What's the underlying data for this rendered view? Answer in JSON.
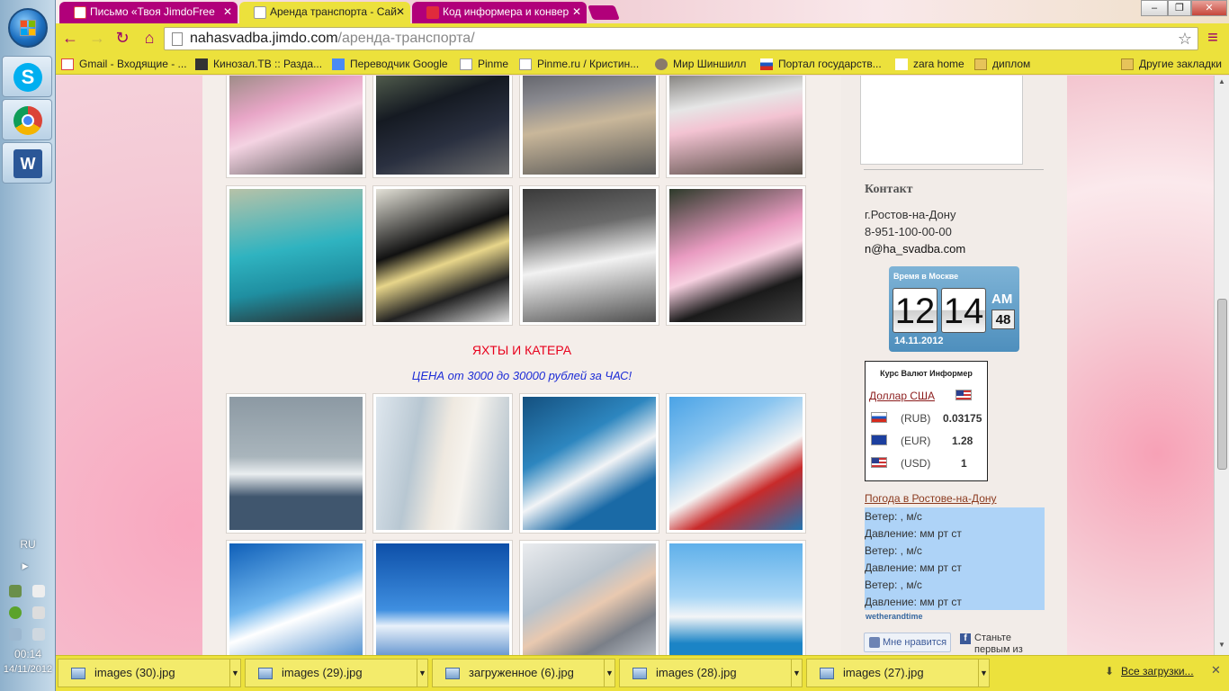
{
  "browser": {
    "tabs": [
      {
        "label": "Письмо «Твоя JimdoFree",
        "active": false
      },
      {
        "label": "Аренда транспорта - Сай",
        "active": true
      },
      {
        "label": "Код информера и конвер",
        "active": false
      }
    ],
    "close_glyph": "✕",
    "url_host": "nahasvadba.jimdo.com",
    "url_path": "/аренда-транспорта/",
    "window_buttons": [
      "‒",
      "❐",
      "✕"
    ],
    "nav_icons": [
      "back-arrow-icon",
      "forward-arrow-icon",
      "reload-icon",
      "home-icon"
    ],
    "star_glyph": "☆",
    "menu_glyph": "≡",
    "bookmarks": [
      "Gmail - Входящие - ...",
      "Кинозал.ТВ :: Разда...",
      "Переводчик Google",
      "Pinme",
      "Pinme.ru / Кристин...",
      "Мир Шиншилл",
      "Портал государств...",
      "zara home",
      "диплом"
    ],
    "other_bookmarks": "Другие закладки",
    "accent_color": "#ece13c",
    "tab_color": "#b1007a"
  },
  "taskbar": {
    "language": "RU",
    "time": "00:14",
    "date": "14/11/2012",
    "pinned_apps": [
      "skype-icon",
      "chrome-icon",
      "word-icon"
    ]
  },
  "page": {
    "yachts_title": "ЯХТЫ И КАТЕРА",
    "yachts_price": "ЦЕНА от 3000 до 30000 рублей за ЧАС!",
    "contact": {
      "heading": "Контакт",
      "city": "г.Ростов-на-Дону",
      "phone": "8-951-100-00-00",
      "email": "n@ha_svadba.com"
    },
    "clock": {
      "title": "Время в Москве",
      "hours": "12",
      "minutes": "14",
      "ampm": "AM",
      "seconds": "48",
      "date": "14.11.2012"
    },
    "currency": {
      "title": "Курс Валют Информер",
      "base": "Доллар США",
      "rows": [
        {
          "code": "(RUB)",
          "value": "0.03175"
        },
        {
          "code": "(EUR)",
          "value": "1.28"
        },
        {
          "code": "(USD)",
          "value": "1"
        }
      ]
    },
    "weather": {
      "link": "Погода в Ростове-на-Дону",
      "lines": [
        "Ветер: , м/с",
        "Давление:  мм рт ст",
        "Ветер: , м/с",
        "Давление:  мм рт ст",
        "Ветер: , м/с",
        "Давление:  мм рт ст"
      ],
      "brand": "wetherandtime"
    },
    "social": {
      "like_label": "Мне нравится",
      "fb_text": "Станьте первым из"
    }
  },
  "downloads": {
    "items": [
      "images (30).jpg",
      "images (29).jpg",
      "загруженное (6).jpg",
      "images (28).jpg",
      "images (27).jpg"
    ],
    "all_label": "Все загрузки..."
  }
}
